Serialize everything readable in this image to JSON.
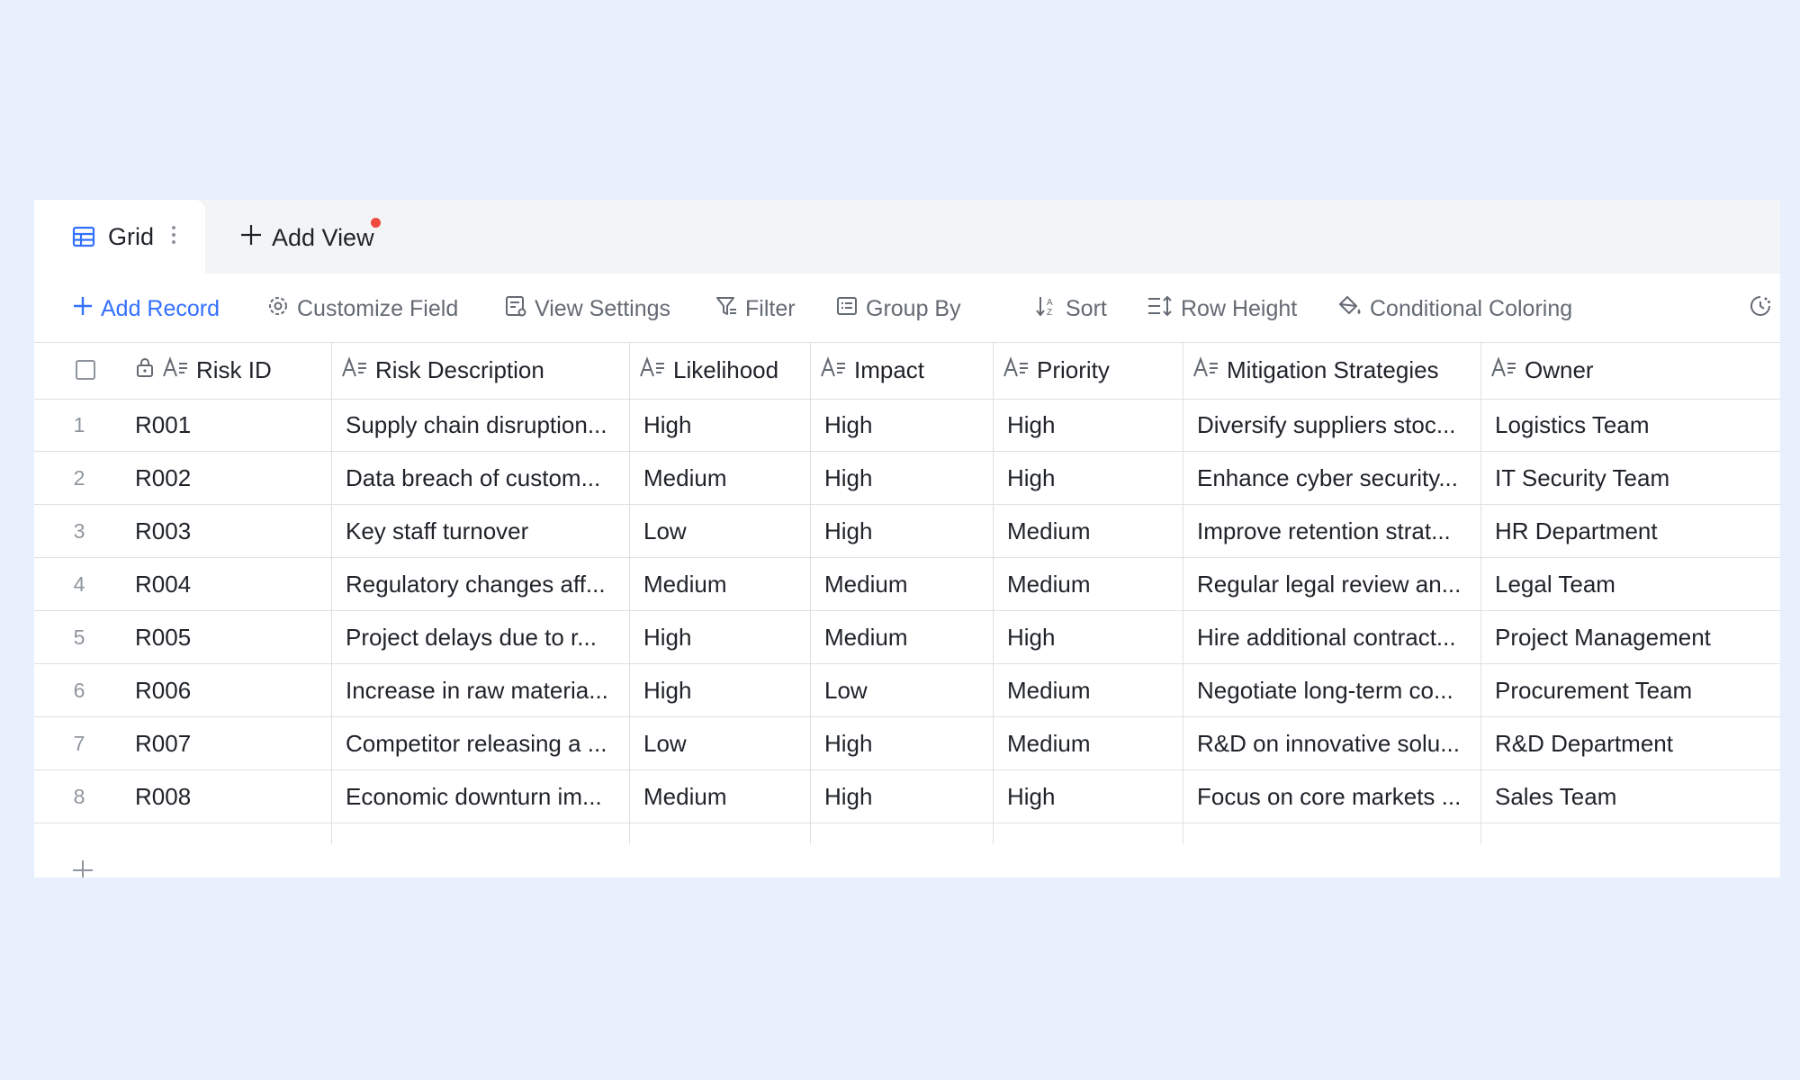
{
  "tabs": {
    "active": "Grid",
    "add_view": "Add View"
  },
  "toolbar": {
    "add_record": "Add Record",
    "customize_field": "Customize Field",
    "view_settings": "View Settings",
    "filter": "Filter",
    "group_by": "Group By",
    "sort": "Sort",
    "row_height": "Row Height",
    "conditional_coloring": "Conditional Coloring"
  },
  "columns": [
    "Risk ID",
    "Risk Description",
    "Likelihood",
    "Impact",
    "Priority",
    "Mitigation Strategies",
    "Owner"
  ],
  "rows": [
    {
      "num": "1",
      "id": "R001",
      "desc": "Supply chain disruption...",
      "likelihood": "High",
      "impact": "High",
      "priority": "High",
      "mitigation": "Diversify suppliers stoc...",
      "owner": "Logistics Team"
    },
    {
      "num": "2",
      "id": "R002",
      "desc": "Data breach of custom...",
      "likelihood": "Medium",
      "impact": "High",
      "priority": "High",
      "mitigation": "Enhance cyber security...",
      "owner": "IT Security Team"
    },
    {
      "num": "3",
      "id": "R003",
      "desc": "Key staff turnover",
      "likelihood": "Low",
      "impact": "High",
      "priority": "Medium",
      "mitigation": "Improve retention strat...",
      "owner": "HR Department"
    },
    {
      "num": "4",
      "id": "R004",
      "desc": "Regulatory changes aff...",
      "likelihood": "Medium",
      "impact": "Medium",
      "priority": "Medium",
      "mitigation": "Regular legal review an...",
      "owner": "Legal Team"
    },
    {
      "num": "5",
      "id": "R005",
      "desc": "Project delays due to r...",
      "likelihood": "High",
      "impact": "Medium",
      "priority": "High",
      "mitigation": "Hire additional contract...",
      "owner": "Project Management"
    },
    {
      "num": "6",
      "id": "R006",
      "desc": "Increase in raw materia...",
      "likelihood": "High",
      "impact": "Low",
      "priority": "Medium",
      "mitigation": "Negotiate long-term co...",
      "owner": "Procurement Team"
    },
    {
      "num": "7",
      "id": "R007",
      "desc": "Competitor releasing a ...",
      "likelihood": "Low",
      "impact": "High",
      "priority": "Medium",
      "mitigation": "R&D on innovative solu...",
      "owner": "R&D Department"
    },
    {
      "num": "8",
      "id": "R008",
      "desc": "Economic downturn im...",
      "likelihood": "Medium",
      "impact": "High",
      "priority": "High",
      "mitigation": "Focus on core markets ...",
      "owner": "Sales Team"
    }
  ],
  "colors": {
    "accent": "#3370ff",
    "notification_dot": "#f04a3e",
    "background": "#e8effd"
  },
  "icons": {
    "grid_view": "table-grid-icon",
    "more": "vertical-dots-icon",
    "add": "plus-icon",
    "customize_field": "gear-icon",
    "view_settings": "view-settings-icon",
    "filter": "filter-icon",
    "group_by": "group-list-icon",
    "sort": "sort-icon",
    "row_height": "row-height-icon",
    "conditional_coloring": "paint-bucket-icon",
    "history": "clock-history-icon",
    "lock": "lock-icon",
    "text_field": "text-field-icon"
  }
}
